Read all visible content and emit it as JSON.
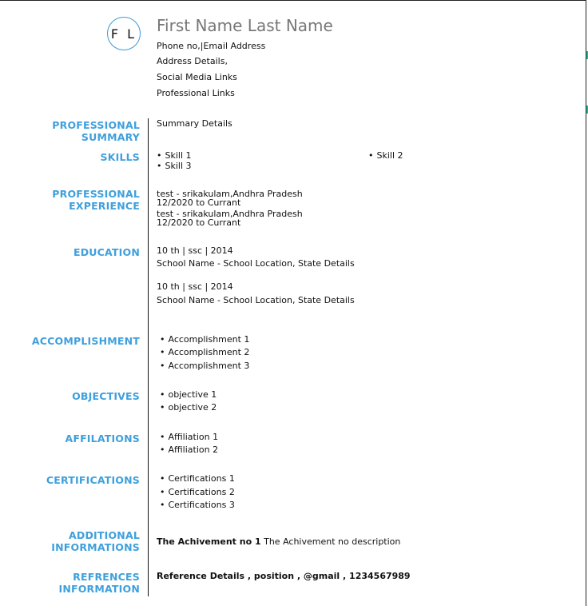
{
  "header": {
    "initials": "F L",
    "name": "First Name Last Name",
    "contact": [
      "Phone no,|Email Address",
      "Address Details,",
      "Social Media Links",
      "Professional Links"
    ]
  },
  "sections": {
    "summary": {
      "label_1": "PROFESSIONAL",
      "label_2": "SUMMARY",
      "text": "Summary Details"
    },
    "skills": {
      "label": "SKILLS",
      "items": [
        "Skill 1",
        "Skill 3",
        "Skill 2"
      ]
    },
    "experience": {
      "label_1": "PROFESSIONAL",
      "label_2": "EXPERIENCE",
      "entries": [
        {
          "place": "test - srikakulam,Andhra Pradesh",
          "dates": "12/2020 to Currant"
        },
        {
          "place": "test - srikakulam,Andhra Pradesh",
          "dates": "12/2020 to Currant"
        }
      ]
    },
    "education": {
      "label": "EDUCATION",
      "entries": [
        {
          "title": "10 th | ssc | 2014",
          "school": "School Name - School Location, State Details"
        },
        {
          "title": "10 th | ssc | 2014",
          "school": "School Name - School Location, State Details"
        }
      ]
    },
    "accomplishment": {
      "label": "ACCOMPLISHMENT",
      "items": [
        "Accomplishment 1",
        "Accomplishment 2",
        "Accomplishment 3"
      ]
    },
    "objectives": {
      "label": "OBJECTIVES",
      "items": [
        "objective 1",
        "objective 2"
      ]
    },
    "affilations": {
      "label": "AFFILATIONS",
      "items": [
        "Affiliation 1",
        "Affiliation 2"
      ]
    },
    "certifications": {
      "label": "CERTIFICATIONS",
      "items": [
        "Certifications 1",
        "Certifications 2",
        "Certifications 3"
      ]
    },
    "additional": {
      "label_1": "ADDITIONAL",
      "label_2": "INFORMATIONS",
      "title": "The Achivement no 1",
      "description": "The Achivement no description"
    },
    "references": {
      "label_1": "REFRENCES",
      "label_2": "INFORMATION",
      "text": "Reference Details , position , @gmail , 1234567989"
    }
  },
  "colors": {
    "accent": "#3ea0dc",
    "circle_border": "#3a9ad9",
    "name": "#777777"
  }
}
